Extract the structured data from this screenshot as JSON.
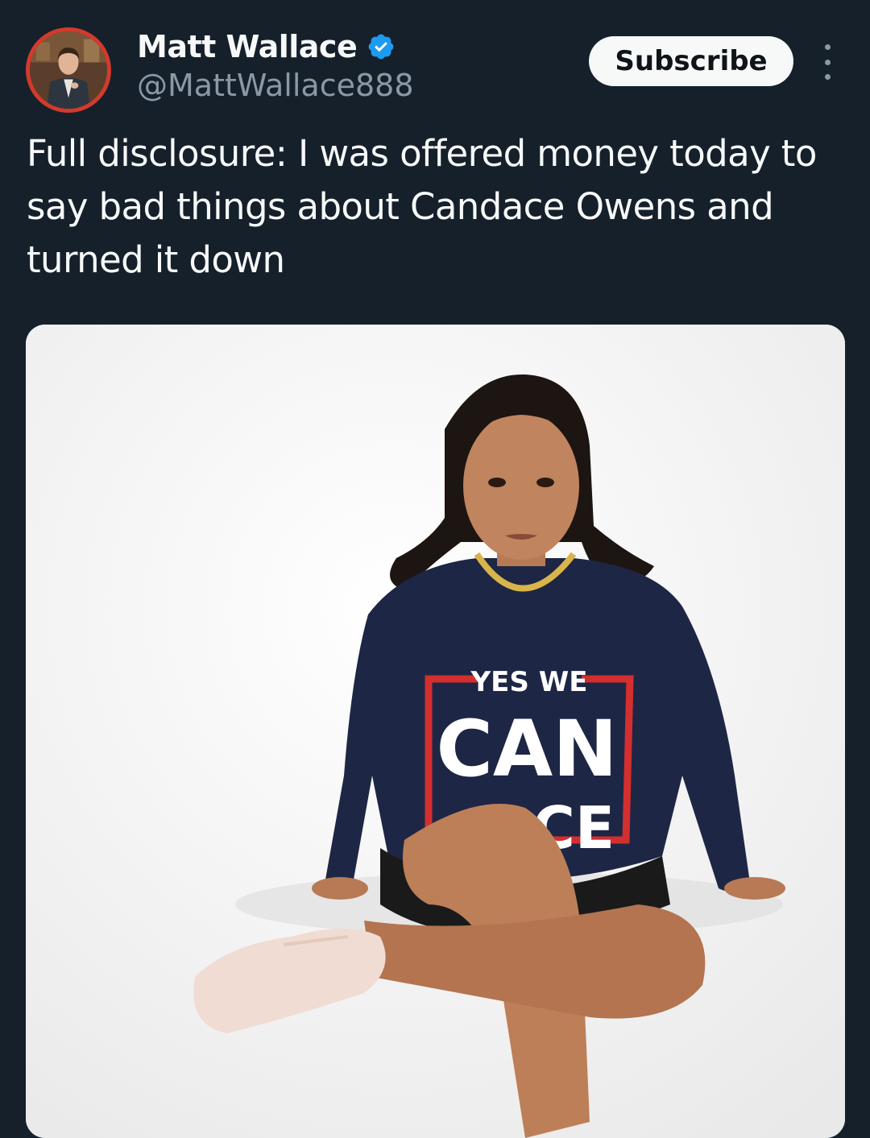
{
  "tweet": {
    "author": {
      "display_name": "Matt Wallace",
      "handle": "@MattWallace888",
      "verified": true
    },
    "subscribe_label": "Subscribe",
    "text": "Full disclosure: I was offered money today to say bad things about Candace Owens and turned it down",
    "media": {
      "shirt_text_top": "YES WE",
      "shirt_text_main": "CAN",
      "shirt_text_bottom": "CE"
    }
  },
  "colors": {
    "background": "#15202b",
    "verified_badge": "#1d9bf0",
    "avatar_ring": "#d33a2c",
    "secondary_text": "#8b98a5"
  }
}
